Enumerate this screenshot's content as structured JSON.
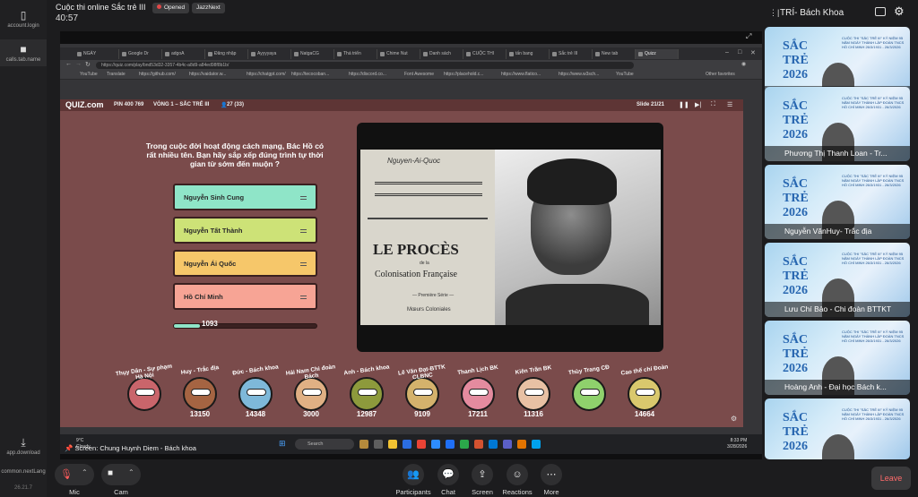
{
  "sidebar": {
    "account_label": "account.login",
    "calls_label": "calls.tab.name",
    "download_label": "app.download",
    "lang_label": "common.nextLang",
    "version": "26.21.7"
  },
  "meeting": {
    "title": "Cuộc thi online Sắc trẻ III",
    "elapsed": "40:57",
    "status_badge": "Opened",
    "host_badge": "JazzNext",
    "host_name": "TRÍ- Bách Khoa"
  },
  "browser": {
    "tabs": [
      "NGÀY",
      "Google Dr",
      "adgoA",
      "Đăng nhập",
      "Ayyyyaya",
      "NatgaCG",
      "Thá triển",
      "Chime Nut",
      "Danh sách",
      "CUỘC THI",
      "tấn bang",
      "Sắc trẻ III",
      "New tab",
      "Quizz"
    ],
    "url": "https://quiz.com/play/bnd53d32-3357-4b4c-a8d9-a84ed98f8b1b/",
    "bookmarks": [
      "YouTube",
      "Translate",
      "https://github.com/",
      "https://vaidator.w...",
      "https://chatgpt.com/",
      "https://tecocoban...",
      "https://discord.co...",
      "Font Awesome",
      "https://placehold.c...",
      "https://www.flatico...",
      "https://www.w3sch...",
      "YouTube",
      "Other favorites"
    ]
  },
  "quiz": {
    "logo": "QUIZ.com",
    "pin": "PIN 400 769",
    "round": "VÒNG 1 – SẮC TRẺ III",
    "players": "27 (33)",
    "slide": "Slide 21/21",
    "question": "Trong cuộc đời hoạt động cách mạng, Bác Hồ có rất nhiều tên. Bạn hãy sắp xếp đúng trình tự thời gian từ sớm đến muộn ?",
    "answers": [
      "Nguyễn Sinh Cung",
      "Nguyễn Tất Thành",
      "Nguyễn Ái Quốc",
      "Hồ Chí Minh"
    ],
    "answer_colors": [
      "#8fe5c8",
      "#cde277",
      "#f6c76a",
      "#f7a495"
    ],
    "timer_value": "1093",
    "timer_fraction": 0.18,
    "image": {
      "author": "Nguyen-Ai-Quoc",
      "title": "LE PROCÈS",
      "sub1": "de la",
      "sub2": "Colonisation Française",
      "sub3": "— Première Série —",
      "sub4": "Mœurs Coloniales"
    },
    "leaderboard": [
      {
        "name": "Thụy Dân - Sự phạm Hà Nội",
        "score": "",
        "color": "#c9656b"
      },
      {
        "name": "Huy - Trắc địa",
        "score": "13150",
        "color": "#a56442"
      },
      {
        "name": "Đức - Bách khoa",
        "score": "14348",
        "color": "#7eb8d9"
      },
      {
        "name": "Hải Nam Chi đoàn Bách",
        "score": "3000",
        "color": "#e0b084"
      },
      {
        "name": "Anh - Bách khoa",
        "score": "12987",
        "color": "#8d9a3c"
      },
      {
        "name": "Lê Văn Đạt-BTTK CLBNC",
        "score": "9109",
        "color": "#d4b26c"
      },
      {
        "name": "Thanh Lịch BK",
        "score": "17211",
        "color": "#e48b9f"
      },
      {
        "name": "Kiên Trần BK",
        "score": "11316",
        "color": "#e8c1a4"
      },
      {
        "name": "Thùy Trang CĐ",
        "score": "",
        "color": "#8fd16c"
      },
      {
        "name": "Cao thế chí Đoàn",
        "score": "14664",
        "color": "#d9c86d"
      }
    ]
  },
  "taskbar": {
    "weather_temp": "9°C",
    "weather_desc": "Cloudy",
    "search": "Search",
    "time": "8:33 PM",
    "date": "3/28/2026"
  },
  "presenter": "Screen: Chung Huynh Diem - Bách khoa",
  "participants": [
    {
      "name": "Chung Huynh Diem - Bách k...",
      "banner": "SẮC TRẺ 2026"
    },
    {
      "name": "Phương Thị Thanh Loan - Tr...",
      "banner": "SẮC TRẺ 2026"
    },
    {
      "name": "Nguyễn VănHuy- Trắc địa",
      "banner": "SẮC TRẺ 2026"
    },
    {
      "name": "Lưu Chí Bảo - Chi đoàn BTTKT",
      "banner": "SẮC TRẺ 2026"
    },
    {
      "name": "Hoàng Anh - Đại học Bách k...",
      "banner": "SẮC TRẺ 2026"
    },
    {
      "name": "",
      "banner": "SẮC TRẺ 2026"
    }
  ],
  "tile_text": "CUỘC THI \"SẮC TRẺ III\" KỶ NIỆM 95 NĂM NGÀY THÀNH LẬP ĐOÀN TNCS HỒ CHÍ MINH 26/3/1931 - 26/3/2026",
  "controls": {
    "mic": "Mic",
    "cam": "Cam",
    "participants": "Participants",
    "chat": "Chat",
    "screen": "Screen",
    "reactions": "Reactions",
    "more": "More",
    "leave": "Leave"
  }
}
